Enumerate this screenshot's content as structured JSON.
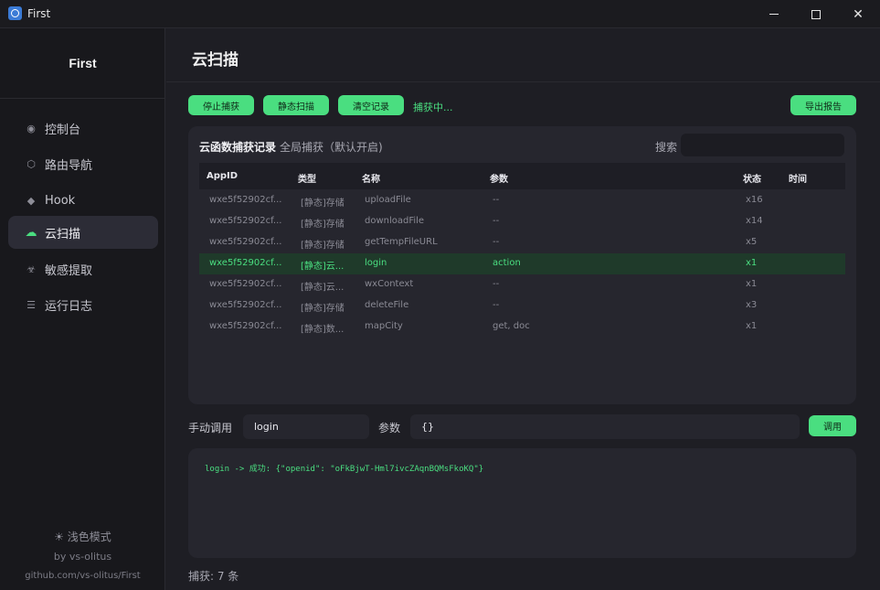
{
  "window": {
    "title": "First"
  },
  "sidebar": {
    "brand": "First",
    "items": [
      {
        "label": "控制台",
        "icon": "dot-icon"
      },
      {
        "label": "路由导航",
        "icon": "hexagon-icon"
      },
      {
        "label": "Hook",
        "icon": "diamond-icon"
      },
      {
        "label": "云扫描",
        "icon": "cloud-icon",
        "active": true
      },
      {
        "label": "敏感提取",
        "icon": "biohazard-icon"
      },
      {
        "label": "运行日志",
        "icon": "list-icon"
      }
    ],
    "theme_toggle": "浅色模式",
    "author": "by vs-olitus",
    "repo": "github.com/vs-olitus/First"
  },
  "page": {
    "title": "云扫描"
  },
  "toolbar": {
    "stop_label": "停止捕获",
    "static_scan_label": "静态扫描",
    "clear_label": "清空记录",
    "status": "捕获中...",
    "export_label": "导出报告",
    "accent": "#4ade80"
  },
  "records": {
    "title": "云函数捕获记录",
    "subtitle": "全局捕获（默认开启)",
    "search_label": "搜索",
    "search_value": "",
    "columns": [
      "AppID",
      "类型",
      "名称",
      "参数",
      "状态",
      "时间"
    ],
    "rows": [
      {
        "appid": "wxe5f52902cf...",
        "type": "[静态]存储",
        "name": "uploadFile",
        "params": "--",
        "status": "x16",
        "time": ""
      },
      {
        "appid": "wxe5f52902cf...",
        "type": "[静态]存储",
        "name": "downloadFile",
        "params": "--",
        "status": "x14",
        "time": ""
      },
      {
        "appid": "wxe5f52902cf...",
        "type": "[静态]存储",
        "name": "getTempFileURL",
        "params": "--",
        "status": "x5",
        "time": ""
      },
      {
        "appid": "wxe5f52902cf...",
        "type": "[静态]云...",
        "name": "login",
        "params": "action",
        "status": "x1",
        "time": "",
        "selected": true
      },
      {
        "appid": "wxe5f52902cf...",
        "type": "[静态]云...",
        "name": "wxContext",
        "params": "--",
        "status": "x1",
        "time": ""
      },
      {
        "appid": "wxe5f52902cf...",
        "type": "[静态]存储",
        "name": "deleteFile",
        "params": "--",
        "status": "x3",
        "time": ""
      },
      {
        "appid": "wxe5f52902cf...",
        "type": "[静态]数...",
        "name": "mapCity",
        "params": "get, doc",
        "status": "x1",
        "time": ""
      }
    ]
  },
  "manual": {
    "label": "手动调用",
    "function_value": "login",
    "param_label": "参数",
    "param_value": "{}",
    "invoke_label": "调用"
  },
  "output": {
    "line": "login -> 成功: {\"openid\": \"oFkBjwT-Hml7ivcZAqnBQMsFkoKQ\"}"
  },
  "footer": {
    "count": "捕获: 7 条"
  }
}
